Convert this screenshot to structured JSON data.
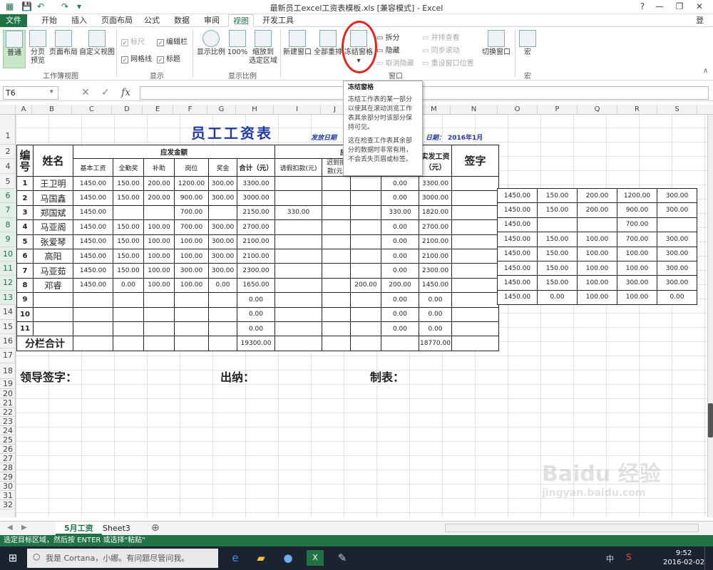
{
  "window": {
    "title": "最新员工excel工资表模板.xls  [兼容模式] - Excel",
    "help": "?",
    "min": "—",
    "restore": "❐",
    "close": "✕",
    "login": "登录"
  },
  "qat": {
    "save": "💾",
    "undo": "↶",
    "redo": "↷",
    "more": "▾"
  },
  "tabs": [
    {
      "label": "文件"
    },
    {
      "label": "开始"
    },
    {
      "label": "插入"
    },
    {
      "label": "页面布局"
    },
    {
      "label": "公式"
    },
    {
      "label": "数据"
    },
    {
      "label": "审阅"
    },
    {
      "label": "视图"
    },
    {
      "label": "开发工具"
    }
  ],
  "ribbon": {
    "views": [
      "普通",
      "分页\n预览",
      "页面布局",
      "自定义视图"
    ],
    "group_views": "工作簿视图",
    "show": {
      "ruler": "标尺",
      "formula_bar": "编辑栏",
      "gridlines": "网格线",
      "headings": "标题",
      "group": "显示"
    },
    "zoom": {
      "zoom": "显示比例",
      "hundred": "100%",
      "fit": "缩放到\n选定区域",
      "group": "显示比例"
    },
    "window": {
      "new": "新建窗口",
      "arrange": "全部重排",
      "freeze": "冻结窗格",
      "split": "拆分",
      "hide": "隐藏",
      "unhide": "取消隐藏",
      "side": "并排查看",
      "sync": "同步滚动",
      "reset": "重设窗口位置",
      "switch": "切换窗口",
      "group": "窗口"
    },
    "macro": {
      "label": "宏",
      "group": "宏"
    }
  },
  "formula_bar": {
    "namebox": "T6",
    "cancel": "✕",
    "enter": "✓",
    "fx": "fx",
    "value": ""
  },
  "tooltip": {
    "title": "冻结窗格",
    "body1": "冻结工作表的某一部分以使其在滚动浏览工作表其余部分时该部分保持可见。",
    "body2": "这在检查工作表其余部分的数据时非常有用，不会丢失页眉或标签。"
  },
  "columns": [
    "A",
    "B",
    "C",
    "D",
    "E",
    "F",
    "G",
    "H",
    "I",
    "J",
    "K",
    "L",
    "M",
    "N",
    "O",
    "P",
    "Q",
    "R",
    "S"
  ],
  "rows": [
    "1",
    "2",
    "4",
    "5",
    "6",
    "7",
    "8",
    "9",
    "10",
    "11",
    "12",
    "13",
    "14",
    "15",
    "16",
    "17",
    "18",
    "19",
    "20",
    "21",
    "22",
    "23",
    "24",
    "25",
    "26",
    "27",
    "28",
    "29",
    "30",
    "31",
    "32"
  ],
  "sheet": {
    "title": "员工工资表",
    "issue_date": "发放日期",
    "date_label": "日期：",
    "date_value": "2016年1月",
    "header": {
      "no": "编\n号",
      "name": "姓名",
      "due": "应发金额",
      "deduct": "应扣",
      "net": "实发工资\n（元）",
      "sign": "签字",
      "base": "基本工资",
      "attend": "全勤奖",
      "subsidy": "补助",
      "post": "岗位",
      "bonus": "奖金",
      "total": "合计（元）",
      "leave": "请假扣款(元)",
      "late": "迟到扣\n款(元)",
      "k": "",
      "l": ""
    },
    "rows": [
      [
        "1",
        "王卫明",
        "1450.00",
        "150.00",
        "200.00",
        "1200.00",
        "300.00",
        "3300.00",
        "",
        "",
        "",
        "0.00",
        "3300.00",
        ""
      ],
      [
        "2",
        "马国鑫",
        "1450.00",
        "150.00",
        "200.00",
        "900.00",
        "300.00",
        "3000.00",
        "",
        "",
        "",
        "0.00",
        "3000.00",
        ""
      ],
      [
        "3",
        "郑国斌",
        "1450.00",
        "",
        "",
        "700.00",
        "",
        "2150.00",
        "330.00",
        "",
        "",
        "330.00",
        "1820.00",
        ""
      ],
      [
        "4",
        "马亚阁",
        "1450.00",
        "150.00",
        "100.00",
        "700.00",
        "300.00",
        "2700.00",
        "",
        "",
        "",
        "0.00",
        "2700.00",
        ""
      ],
      [
        "5",
        "张爱琴",
        "1450.00",
        "150.00",
        "100.00",
        "100.00",
        "300.00",
        "2100.00",
        "",
        "",
        "",
        "0.00",
        "2100.00",
        ""
      ],
      [
        "6",
        "高阳",
        "1450.00",
        "150.00",
        "100.00",
        "100.00",
        "300.00",
        "2100.00",
        "",
        "",
        "",
        "0.00",
        "2100.00",
        ""
      ],
      [
        "7",
        "马亚茹",
        "1450.00",
        "150.00",
        "100.00",
        "300.00",
        "300.00",
        "2300.00",
        "",
        "",
        "",
        "0.00",
        "2300.00",
        ""
      ],
      [
        "8",
        "邓睿",
        "1450.00",
        "0.00",
        "100.00",
        "100.00",
        "0.00",
        "1650.00",
        "",
        "",
        "200.00",
        "200.00",
        "1450.00",
        ""
      ],
      [
        "9",
        "",
        "",
        "",
        "",
        "",
        "",
        "0.00",
        "",
        "",
        "",
        "0.00",
        "0.00",
        ""
      ],
      [
        "10",
        "",
        "",
        "",
        "",
        "",
        "",
        "0.00",
        "",
        "",
        "",
        "0.00",
        "0.00",
        ""
      ],
      [
        "11",
        "",
        "",
        "",
        "",
        "",
        "",
        "0.00",
        "",
        "",
        "",
        "0.00",
        "0.00",
        ""
      ]
    ],
    "total": {
      "label": "分栏合计",
      "sum": "19300.00",
      "net": "18770.00"
    },
    "right_rows": [
      [
        "1450.00",
        "150.00",
        "200.00",
        "1200.00",
        "300.00"
      ],
      [
        "1450.00",
        "150.00",
        "200.00",
        "900.00",
        "300.00"
      ],
      [
        "1450.00",
        "",
        "",
        "700.00",
        ""
      ],
      [
        "1450.00",
        "150.00",
        "100.00",
        "700.00",
        "300.00"
      ],
      [
        "1450.00",
        "150.00",
        "100.00",
        "100.00",
        "300.00"
      ],
      [
        "1450.00",
        "150.00",
        "100.00",
        "100.00",
        "300.00"
      ],
      [
        "1450.00",
        "150.00",
        "100.00",
        "300.00",
        "300.00"
      ],
      [
        "1450.00",
        "0.00",
        "100.00",
        "100.00",
        "0.00"
      ]
    ],
    "sign_leader": "领导签字：",
    "sign_cashier": "出纳：",
    "sign_maker": "制表："
  },
  "sheet_tabs": [
    "5月工资",
    "Sheet3"
  ],
  "add_sheet": "⊕",
  "status": "选定目标区域，然后按 ENTER 或选择\"粘贴\"",
  "taskbar": {
    "search": "我是 Cortana，小娜。有问题尽管问我。",
    "time": "9:52",
    "date": "2016-02-02",
    "ime": "中"
  },
  "watermark": "Baidu 经验",
  "watermark_url": "jingyan.baidu.com"
}
